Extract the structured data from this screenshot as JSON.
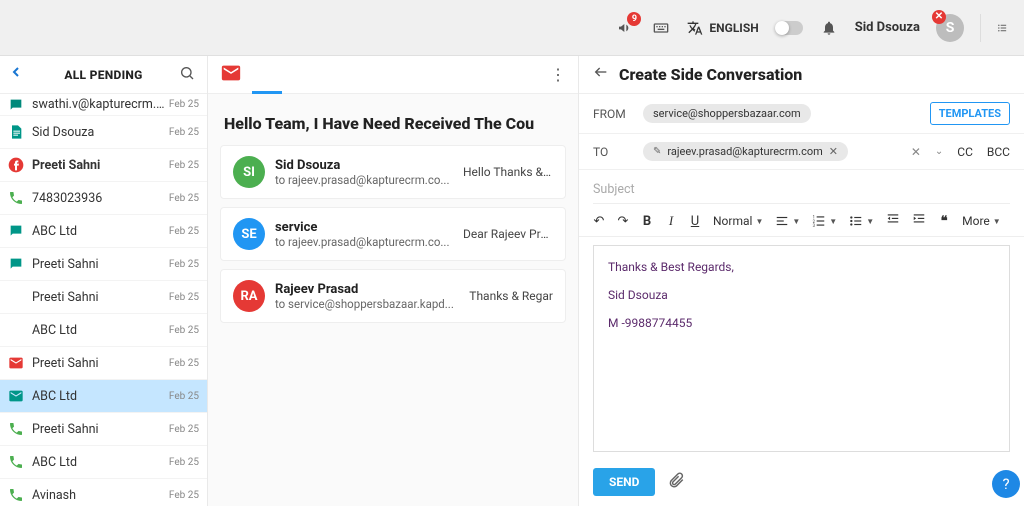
{
  "topbar": {
    "notification_count": "9",
    "language": "ENGLISH",
    "user_name": "Sid Dsouza",
    "user_initial": "S"
  },
  "sidebar": {
    "title": "ALL PENDING",
    "items": [
      {
        "name": "swathi.v@kapturecrm.com",
        "date": "Feb 25",
        "icon": "chat",
        "color": "#00897b",
        "bold": false,
        "truncated": true
      },
      {
        "name": "Sid Dsouza",
        "date": "Feb 25",
        "icon": "doc",
        "color": "#009688",
        "bold": false
      },
      {
        "name": "Preeti Sahni",
        "date": "Feb 25",
        "icon": "fb",
        "color": "#e53935",
        "bold": true
      },
      {
        "name": "7483023936",
        "date": "Feb 25",
        "icon": "phone",
        "color": "#4caf50",
        "bold": false
      },
      {
        "name": "ABC Ltd",
        "date": "Feb 25",
        "icon": "chat",
        "color": "#009688",
        "bold": false
      },
      {
        "name": "Preeti Sahni",
        "date": "Feb 25",
        "icon": "chat",
        "color": "#009688",
        "bold": false
      },
      {
        "name": "Preeti Sahni",
        "date": "Feb 25",
        "icon": "wa",
        "color": "#25d366",
        "bold": false
      },
      {
        "name": "ABC Ltd",
        "date": "Feb 25",
        "icon": "wa",
        "color": "#25d366",
        "bold": false
      },
      {
        "name": "Preeti Sahni",
        "date": "Feb 25",
        "icon": "mail",
        "color": "#e53935",
        "bold": false
      },
      {
        "name": "ABC Ltd",
        "date": "Feb 25",
        "icon": "mail",
        "color": "#009688",
        "bold": false,
        "selected": true
      },
      {
        "name": "Preeti Sahni",
        "date": "Feb 25",
        "icon": "phone",
        "color": "#4caf50",
        "bold": false
      },
      {
        "name": "ABC Ltd",
        "date": "Feb 25",
        "icon": "phone",
        "color": "#4caf50",
        "bold": false
      },
      {
        "name": "Avinash",
        "date": "Feb 25",
        "icon": "phone",
        "color": "#4caf50",
        "bold": false
      }
    ]
  },
  "thread": {
    "subject": "Hello Team, I Have Need Received The Cou",
    "messages": [
      {
        "initials": "SI",
        "color": "#4caf50",
        "from": "Sid Dsouza",
        "to": "to rajeev.prasad@kapturecrm.co...",
        "preview": "Hello Thanks & B"
      },
      {
        "initials": "SE",
        "color": "#2196f3",
        "from": "service",
        "to": "to rajeev.prasad@kapturecrm.co...",
        "preview": "Dear Rajeev Pras"
      },
      {
        "initials": "RA",
        "color": "#e53935",
        "from": "Rajeev Prasad",
        "to": "to service@shoppersbazaar.kapd...",
        "preview": "Thanks & Regar"
      }
    ]
  },
  "compose": {
    "title": "Create Side Conversation",
    "from_label": "FROM",
    "from_value": "service@shoppersbazaar.com",
    "to_label": "TO",
    "to_value": "rajeev.prasad@kapturecrm.com",
    "templates_label": "TEMPLATES",
    "cc_label": "CC",
    "bcc_label": "BCC",
    "subject_placeholder": "Subject",
    "toolbar_normal": "Normal",
    "toolbar_more": "More",
    "body_line1": "Thanks & Best Regards,",
    "body_line2": "Sid Dsouza",
    "body_line3": "M -9988774455",
    "send_label": "SEND"
  }
}
